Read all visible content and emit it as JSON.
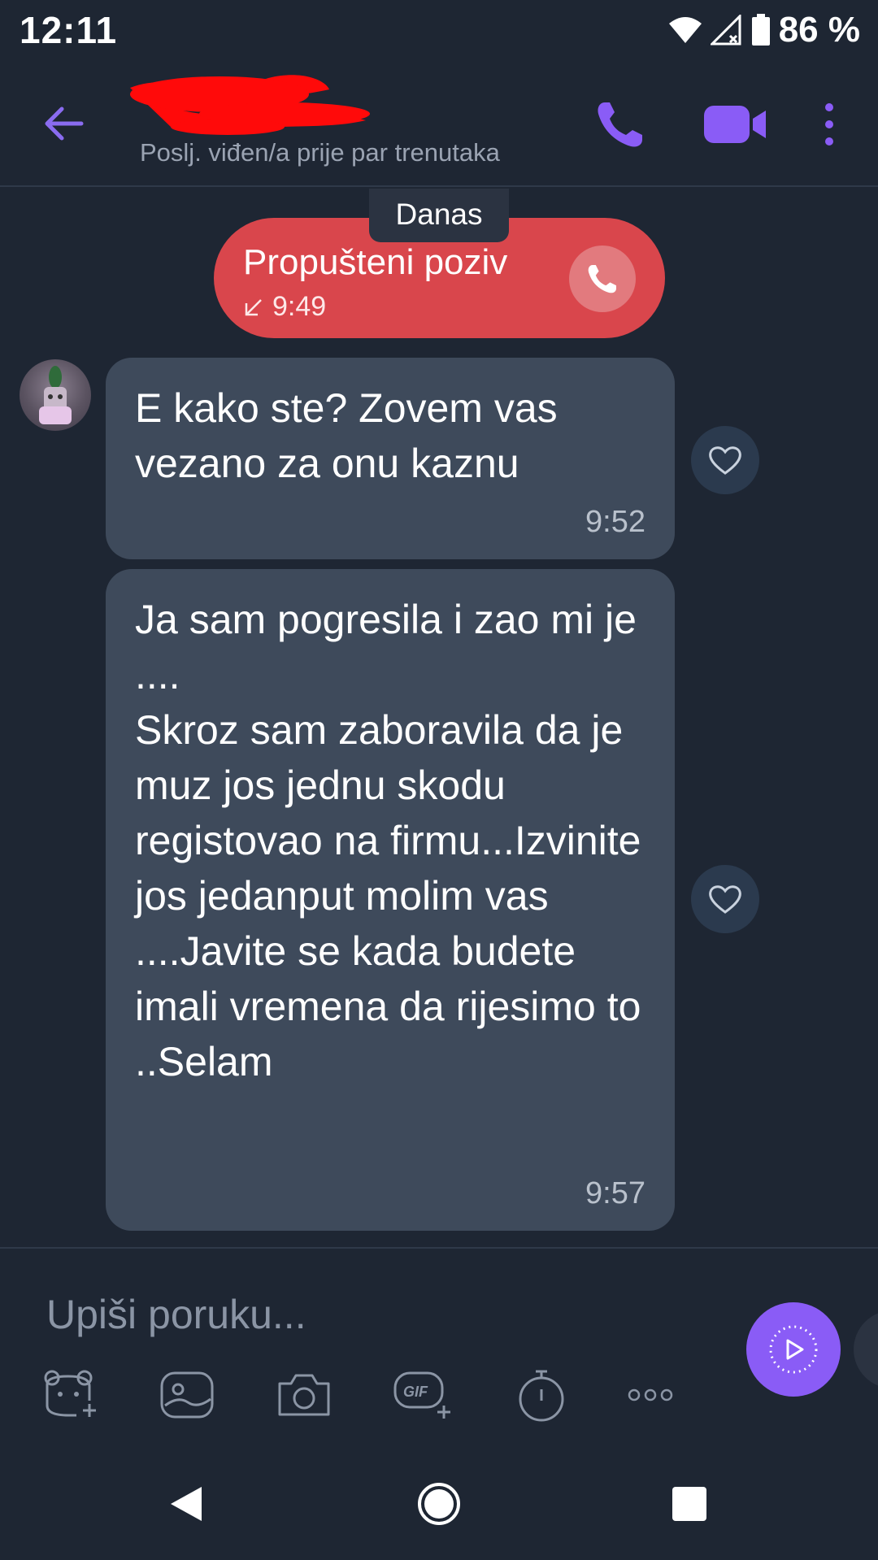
{
  "status_bar": {
    "time": "12:11",
    "battery_percent": "86 %",
    "icons": [
      "wifi-icon",
      "signal-icon",
      "battery-icon"
    ]
  },
  "header": {
    "last_seen": "Poslj. viđen/a prije par trenutaka"
  },
  "chat": {
    "date_label": "Danas",
    "missed_call": {
      "label": "Propušteni poziv",
      "time": "9:49"
    },
    "messages": [
      {
        "text": "E kako ste? Zovem vas vezano za onu kaznu",
        "time": "9:52"
      },
      {
        "text": "Ja sam pogresila i zao mi je ....\nSkroz sam zaboravila da je muz jos jednu skodu registovao na firmu...Izvinite  jos jedanput molim vas ....Javite se kada budete imali vremena da rijesimo to ..Selam",
        "time": "9:57"
      }
    ]
  },
  "composer": {
    "placeholder": "Upiši poruku...",
    "gif_label": "GIF"
  },
  "colors": {
    "background": "#1e2633",
    "bubble": "#3e4a5b",
    "accent": "#8a5cf6",
    "missed_call": "#d9464c"
  }
}
